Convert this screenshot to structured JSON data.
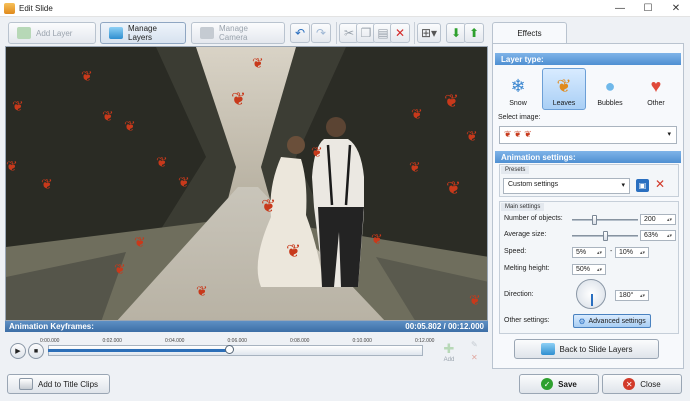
{
  "window": {
    "title": "Edit Slide",
    "min_glyph": "—",
    "max_glyph": "☐",
    "close_glyph": "✕"
  },
  "toolbar": {
    "add_layer": "Add Layer",
    "manage_layers": "Manage Layers",
    "manage_camera": "Manage Camera"
  },
  "keyframes": {
    "title": "Animation Keyframes:",
    "position": "00:05.802 / 00:12.000",
    "ticks": [
      "0:00.000",
      "0:02.000",
      "0:04.000",
      "0:06.000",
      "0:08.000",
      "0:10.000",
      "0:12.000"
    ],
    "progress": 0.4835,
    "add_label": "Add"
  },
  "panel": {
    "tab": "Effects",
    "layer_type_title": "Layer type:",
    "layer_types": [
      {
        "label": "Snow",
        "icon": "snowflake-icon"
      },
      {
        "label": "Leaves",
        "icon": "maple-leaf-icon",
        "selected": true
      },
      {
        "label": "Bubbles",
        "icon": "bubbles-icon"
      },
      {
        "label": "Other",
        "icon": "hearts-icon"
      }
    ],
    "select_image_label": "Select image:",
    "animation_settings_title": "Animation settings:",
    "presets_label": "Presets",
    "preset_value": "Custom settings",
    "main_settings_label": "Main settings",
    "number_of_objects_label": "Number of objects:",
    "number_of_objects": "200",
    "number_of_objects_level": 0.33,
    "average_size_label": "Average size:",
    "average_size": "63%",
    "average_size_level": 0.5,
    "speed_label": "Speed:",
    "speed_min": "5%",
    "speed_dash": "-",
    "speed_max": "10%",
    "melting_height_label": "Melting height:",
    "melting_height": "50%",
    "direction_label": "Direction:",
    "direction": "180°",
    "other_settings_label": "Other settings:",
    "advanced_settings": "Advanced settings",
    "back_button": "Back to Slide Layers"
  },
  "footer": {
    "add_to_title_clips": "Add to Title Clips",
    "save": "Save",
    "close": "Close"
  },
  "colors": {
    "accent": "#4f8fd2",
    "leaf": "#c8391b",
    "save_green": "#2ea02e",
    "close_red": "#d23a2a"
  }
}
